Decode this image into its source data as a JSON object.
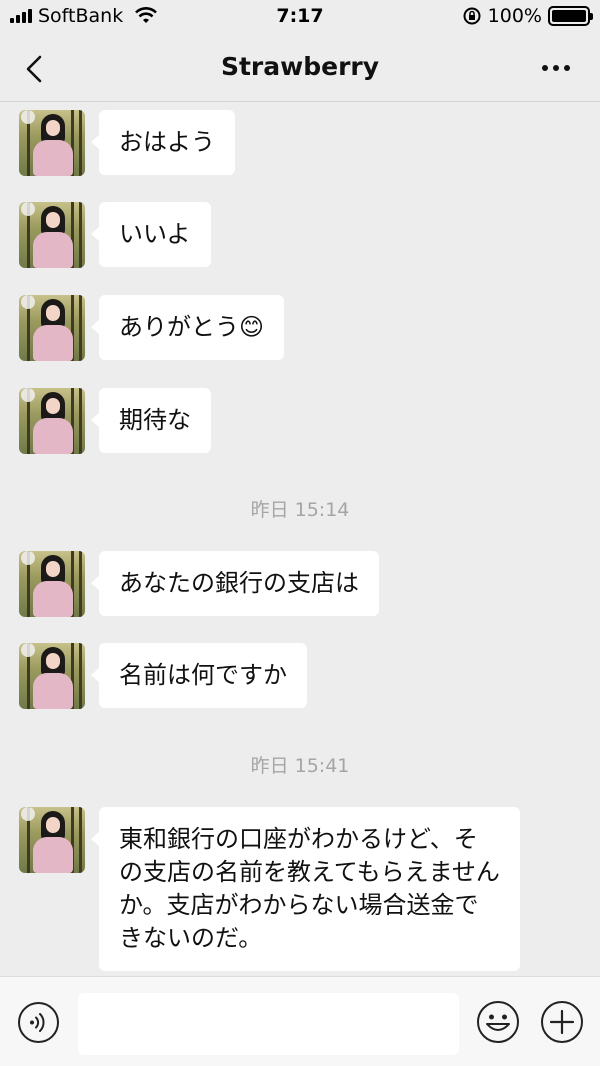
{
  "status_bar": {
    "carrier": "SoftBank",
    "time": "7:17",
    "battery": "100%"
  },
  "nav": {
    "title": "Strawberry"
  },
  "messages": [
    {
      "type": "received",
      "text": "おはよう"
    },
    {
      "type": "received",
      "text": "いいよ"
    },
    {
      "type": "received",
      "text": "ありがとう😊"
    },
    {
      "type": "received",
      "text": "期待な"
    },
    {
      "type": "time",
      "text": "昨日 15:14"
    },
    {
      "type": "received",
      "text": "あなたの銀行の支店は"
    },
    {
      "type": "received",
      "text": "名前は何ですか"
    },
    {
      "type": "time",
      "text": "昨日 15:41"
    },
    {
      "type": "received",
      "text": "東和銀行の口座がわかるけど、その支店の名前を教えてもらえませんか。支店がわからない場合送金できないのだ。"
    }
  ],
  "input": {
    "value": "",
    "placeholder": ""
  },
  "icons": {
    "back": "chevron-left-icon",
    "more": "more-dots-icon",
    "voice": "voice-icon",
    "emoji": "emoji-icon",
    "plus": "plus-icon"
  }
}
